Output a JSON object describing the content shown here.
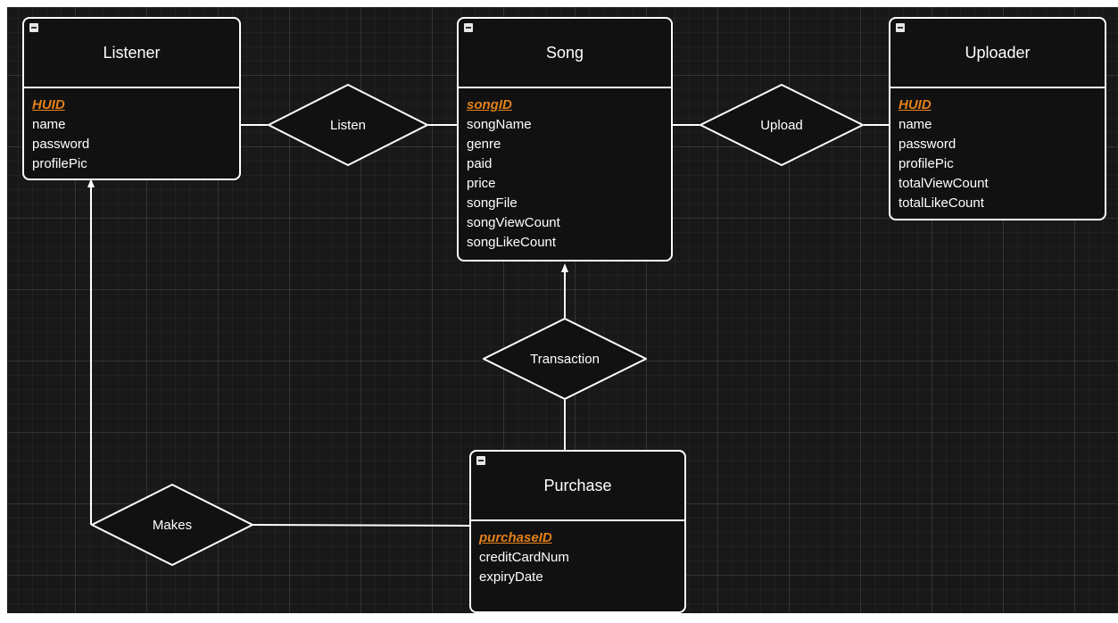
{
  "entities": {
    "listener": {
      "name": "Listener",
      "pk": "HUID",
      "attributes": [
        "name",
        "password",
        "profilePic"
      ]
    },
    "song": {
      "name": "Song",
      "pk": "songID",
      "attributes": [
        "songName",
        "genre",
        "paid",
        "price",
        "songFile",
        "songViewCount",
        "songLikeCount"
      ]
    },
    "uploader": {
      "name": "Uploader",
      "pk": "HUID",
      "attributes": [
        "name",
        "password",
        "profilePic",
        "totalViewCount",
        "totalLikeCount"
      ]
    },
    "purchase": {
      "name": "Purchase",
      "pk": "purchaseID",
      "attributes": [
        "creditCardNum",
        "expiryDate"
      ]
    }
  },
  "relationships": {
    "listen": "Listen",
    "upload": "Upload",
    "transaction": "Transaction",
    "makes": "Makes"
  },
  "colors": {
    "canvas": "#181818",
    "stroke": "#ffffff",
    "primary_key": "#e3811a"
  }
}
